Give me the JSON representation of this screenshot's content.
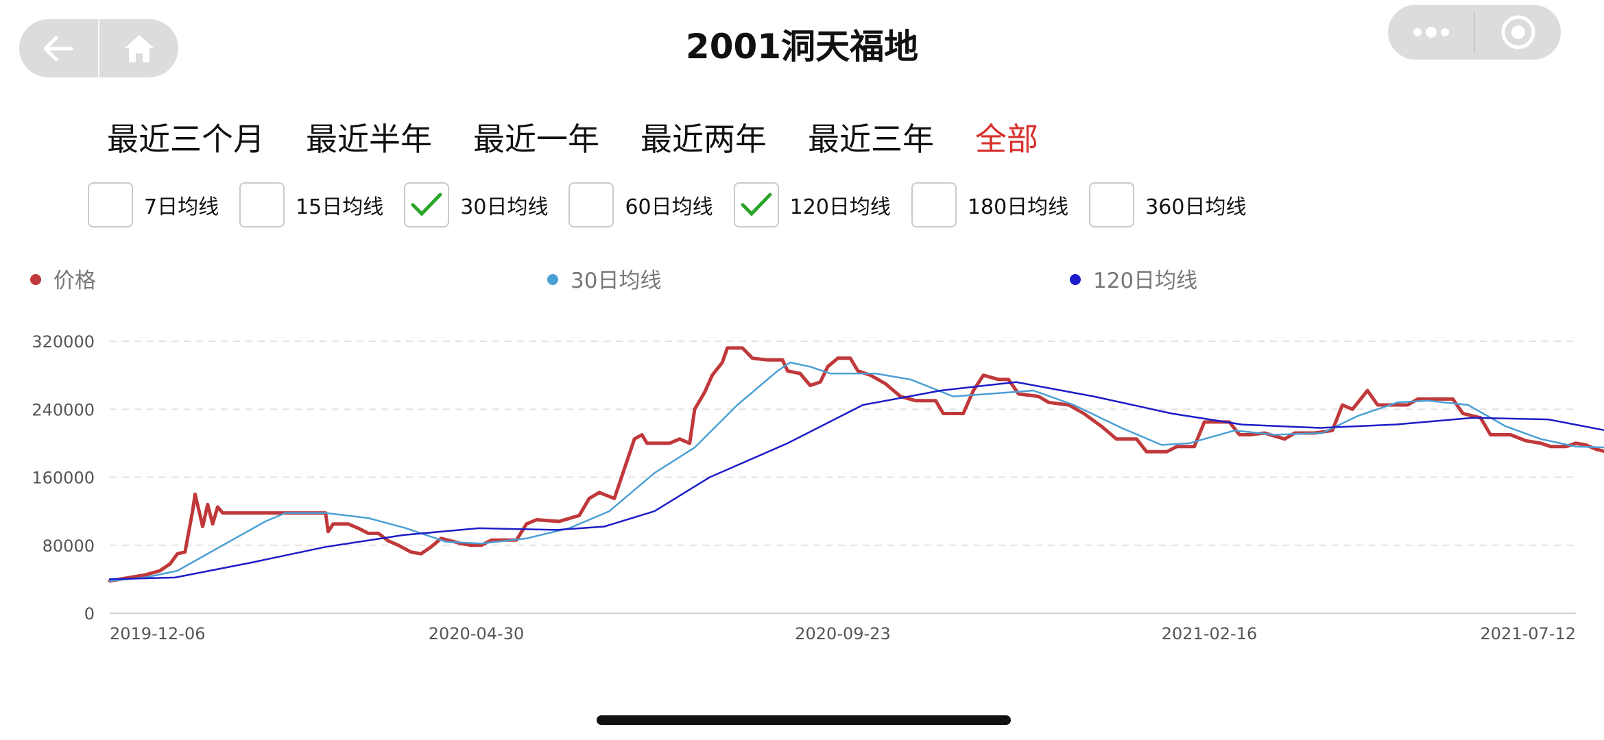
{
  "header": {
    "title": "2001洞天福地",
    "back_icon": "back-arrow-icon",
    "home_icon": "home-icon",
    "more_icon": "more-dots-icon",
    "close_icon": "target-circle-icon"
  },
  "range_tabs": [
    {
      "label": "最近三个月",
      "active": false
    },
    {
      "label": "最近半年",
      "active": false
    },
    {
      "label": "最近一年",
      "active": false
    },
    {
      "label": "最近两年",
      "active": false
    },
    {
      "label": "最近三年",
      "active": false
    },
    {
      "label": "全部",
      "active": true
    }
  ],
  "ma_options": [
    {
      "label": "7日均线",
      "checked": false
    },
    {
      "label": "15日均线",
      "checked": false
    },
    {
      "label": "30日均线",
      "checked": true
    },
    {
      "label": "60日均线",
      "checked": false
    },
    {
      "label": "120日均线",
      "checked": true
    },
    {
      "label": "180日均线",
      "checked": false
    },
    {
      "label": "360日均线",
      "checked": false
    }
  ],
  "colors": {
    "accent": "#d8302c",
    "check": "#2aa52a",
    "price": "#c0383a",
    "ma30": "#4b9fd5",
    "ma120": "#1c1cc8"
  },
  "chart_data": {
    "type": "line",
    "x_ticks": [
      "2019-12-06",
      "2020-04-30",
      "2020-09-23",
      "2021-02-16",
      "2021-07-12"
    ],
    "ylim": [
      0,
      320000
    ],
    "y_ticks": [
      0,
      80000,
      160000,
      240000,
      320000
    ],
    "grid": true,
    "legend_position": "top",
    "series": [
      {
        "name": "价格",
        "color": "#c0383a",
        "points": [
          [
            "2019-12-06",
            38000
          ],
          [
            "2019-12-10",
            40000
          ],
          [
            "2019-12-14",
            42000
          ],
          [
            "2019-12-20",
            45000
          ],
          [
            "2019-12-26",
            50000
          ],
          [
            "2019-12-30",
            58000
          ],
          [
            "2020-01-02",
            70000
          ],
          [
            "2020-01-05",
            72000
          ],
          [
            "2020-01-08",
            120000
          ],
          [
            "2020-01-09",
            140000
          ],
          [
            "2020-01-11",
            115000
          ],
          [
            "2020-01-12",
            102000
          ],
          [
            "2020-01-14",
            128000
          ],
          [
            "2020-01-16",
            105000
          ],
          [
            "2020-01-18",
            125000
          ],
          [
            "2020-01-20",
            118000
          ],
          [
            "2020-02-20",
            118000
          ],
          [
            "2020-03-01",
            118000
          ],
          [
            "2020-03-02",
            96000
          ],
          [
            "2020-03-04",
            105000
          ],
          [
            "2020-03-10",
            105000
          ],
          [
            "2020-03-14",
            100000
          ],
          [
            "2020-03-18",
            94000
          ],
          [
            "2020-03-22",
            94000
          ],
          [
            "2020-03-26",
            85000
          ],
          [
            "2020-03-30",
            80000
          ],
          [
            "2020-04-04",
            72000
          ],
          [
            "2020-04-08",
            70000
          ],
          [
            "2020-04-12",
            78000
          ],
          [
            "2020-04-16",
            88000
          ],
          [
            "2020-04-20",
            85000
          ],
          [
            "2020-04-24",
            82000
          ],
          [
            "2020-04-28",
            80000
          ],
          [
            "2020-05-02",
            80000
          ],
          [
            "2020-05-06",
            86000
          ],
          [
            "2020-05-16",
            86000
          ],
          [
            "2020-05-20",
            105000
          ],
          [
            "2020-05-24",
            110000
          ],
          [
            "2020-06-02",
            108000
          ],
          [
            "2020-06-10",
            115000
          ],
          [
            "2020-06-14",
            135000
          ],
          [
            "2020-06-18",
            142000
          ],
          [
            "2020-06-24",
            135000
          ],
          [
            "2020-06-28",
            170000
          ],
          [
            "2020-07-02",
            205000
          ],
          [
            "2020-07-05",
            210000
          ],
          [
            "2020-07-07",
            200000
          ],
          [
            "2020-07-16",
            200000
          ],
          [
            "2020-07-20",
            205000
          ],
          [
            "2020-07-24",
            200000
          ],
          [
            "2020-07-26",
            240000
          ],
          [
            "2020-07-30",
            260000
          ],
          [
            "2020-08-02",
            280000
          ],
          [
            "2020-08-06",
            295000
          ],
          [
            "2020-08-08",
            312000
          ],
          [
            "2020-08-14",
            312000
          ],
          [
            "2020-08-18",
            300000
          ],
          [
            "2020-08-24",
            298000
          ],
          [
            "2020-08-30",
            298000
          ],
          [
            "2020-09-01",
            285000
          ],
          [
            "2020-09-06",
            282000
          ],
          [
            "2020-09-10",
            268000
          ],
          [
            "2020-09-14",
            272000
          ],
          [
            "2020-09-17",
            290000
          ],
          [
            "2020-09-21",
            300000
          ],
          [
            "2020-09-26",
            300000
          ],
          [
            "2020-09-29",
            285000
          ],
          [
            "2020-10-04",
            280000
          ],
          [
            "2020-10-10",
            270000
          ],
          [
            "2020-10-16",
            255000
          ],
          [
            "2020-10-22",
            250000
          ],
          [
            "2020-10-30",
            250000
          ],
          [
            "2020-11-02",
            235000
          ],
          [
            "2020-11-10",
            235000
          ],
          [
            "2020-11-14",
            262000
          ],
          [
            "2020-11-18",
            280000
          ],
          [
            "2020-11-24",
            275000
          ],
          [
            "2020-11-28",
            275000
          ],
          [
            "2020-12-02",
            258000
          ],
          [
            "2020-12-10",
            255000
          ],
          [
            "2020-12-14",
            248000
          ],
          [
            "2020-12-22",
            245000
          ],
          [
            "2020-12-28",
            235000
          ],
          [
            "2021-01-04",
            220000
          ],
          [
            "2021-01-10",
            205000
          ],
          [
            "2021-01-18",
            205000
          ],
          [
            "2021-01-22",
            190000
          ],
          [
            "2021-01-30",
            190000
          ],
          [
            "2021-02-03",
            196000
          ],
          [
            "2021-02-10",
            196000
          ],
          [
            "2021-02-14",
            225000
          ],
          [
            "2021-02-24",
            225000
          ],
          [
            "2021-02-28",
            210000
          ],
          [
            "2021-03-04",
            210000
          ],
          [
            "2021-03-10",
            212000
          ],
          [
            "2021-03-18",
            205000
          ],
          [
            "2021-03-22",
            212000
          ],
          [
            "2021-03-30",
            212000
          ],
          [
            "2021-04-06",
            215000
          ],
          [
            "2021-04-10",
            245000
          ],
          [
            "2021-04-14",
            240000
          ],
          [
            "2021-04-20",
            262000
          ],
          [
            "2021-04-24",
            245000
          ],
          [
            "2021-05-06",
            245000
          ],
          [
            "2021-05-10",
            252000
          ],
          [
            "2021-05-24",
            252000
          ],
          [
            "2021-05-28",
            235000
          ],
          [
            "2021-06-04",
            230000
          ],
          [
            "2021-06-08",
            210000
          ],
          [
            "2021-06-16",
            210000
          ],
          [
            "2021-06-22",
            203000
          ],
          [
            "2021-06-28",
            200000
          ],
          [
            "2021-07-02",
            196000
          ],
          [
            "2021-07-08",
            196000
          ],
          [
            "2021-07-12",
            200000
          ],
          [
            "2021-07-16",
            198000
          ],
          [
            "2021-07-20",
            193000
          ],
          [
            "2021-07-24",
            190000
          ]
        ]
      },
      {
        "name": "30日均线",
        "color": "#4b9fd5",
        "points": [
          [
            "2019-12-06",
            38000
          ],
          [
            "2019-12-20",
            42000
          ],
          [
            "2020-01-02",
            50000
          ],
          [
            "2020-01-20",
            80000
          ],
          [
            "2020-02-06",
            108000
          ],
          [
            "2020-02-14",
            118000
          ],
          [
            "2020-03-01",
            118000
          ],
          [
            "2020-03-18",
            112000
          ],
          [
            "2020-04-02",
            100000
          ],
          [
            "2020-04-18",
            84000
          ],
          [
            "2020-05-02",
            82000
          ],
          [
            "2020-05-20",
            88000
          ],
          [
            "2020-06-06",
            100000
          ],
          [
            "2020-06-22",
            120000
          ],
          [
            "2020-07-10",
            165000
          ],
          [
            "2020-07-26",
            195000
          ],
          [
            "2020-08-12",
            245000
          ],
          [
            "2020-08-28",
            285000
          ],
          [
            "2020-09-02",
            295000
          ],
          [
            "2020-09-10",
            290000
          ],
          [
            "2020-09-18",
            282000
          ],
          [
            "2020-10-06",
            282000
          ],
          [
            "2020-10-20",
            275000
          ],
          [
            "2020-11-06",
            255000
          ],
          [
            "2020-11-20",
            258000
          ],
          [
            "2020-12-08",
            262000
          ],
          [
            "2020-12-24",
            245000
          ],
          [
            "2021-01-12",
            218000
          ],
          [
            "2021-01-28",
            198000
          ],
          [
            "2021-02-08",
            200000
          ],
          [
            "2021-02-26",
            215000
          ],
          [
            "2021-03-14",
            210000
          ],
          [
            "2021-04-02",
            212000
          ],
          [
            "2021-04-16",
            232000
          ],
          [
            "2021-05-02",
            248000
          ],
          [
            "2021-05-14",
            250000
          ],
          [
            "2021-05-30",
            245000
          ],
          [
            "2021-06-14",
            220000
          ],
          [
            "2021-06-28",
            205000
          ],
          [
            "2021-07-12",
            196000
          ],
          [
            "2021-07-24",
            195000
          ]
        ]
      },
      {
        "name": "120日均线",
        "color": "#1c1cc8",
        "points": [
          [
            "2019-12-06",
            40000
          ],
          [
            "2020-01-01",
            42000
          ],
          [
            "2020-02-01",
            60000
          ],
          [
            "2020-03-01",
            78000
          ],
          [
            "2020-04-01",
            92000
          ],
          [
            "2020-05-01",
            100000
          ],
          [
            "2020-06-01",
            98000
          ],
          [
            "2020-06-20",
            102000
          ],
          [
            "2020-07-10",
            120000
          ],
          [
            "2020-08-01",
            160000
          ],
          [
            "2020-09-01",
            200000
          ],
          [
            "2020-10-01",
            245000
          ],
          [
            "2020-11-01",
            262000
          ],
          [
            "2020-12-01",
            272000
          ],
          [
            "2021-01-01",
            255000
          ],
          [
            "2021-02-01",
            235000
          ],
          [
            "2021-03-01",
            222000
          ],
          [
            "2021-04-01",
            218000
          ],
          [
            "2021-05-01",
            222000
          ],
          [
            "2021-06-01",
            230000
          ],
          [
            "2021-07-01",
            228000
          ],
          [
            "2021-07-24",
            215000
          ]
        ]
      }
    ]
  }
}
